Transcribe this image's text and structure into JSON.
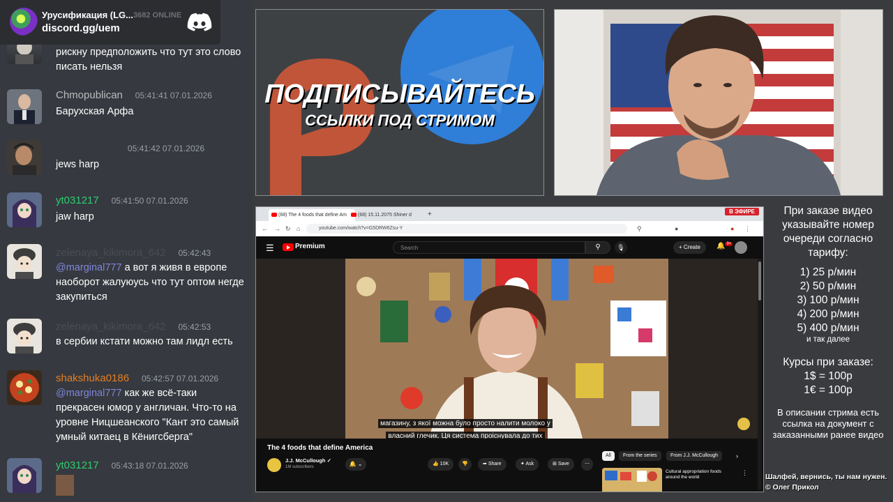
{
  "discord": {
    "server_name": "Урусификация (LG...",
    "online_count": "3682 ONLINE",
    "invite": "discord.gg/uem",
    "messages": [
      {
        "user": "",
        "time": "",
        "text": "рискну предположить что тут это слово писать нельзя",
        "color": "#b9bbbe"
      },
      {
        "user": "Chmopublican",
        "time": "05:41:41 07.01.2026",
        "text": "Барухская Арфа",
        "color": "#b9bbbe"
      },
      {
        "user": "",
        "time": "05:41:42 07.01.2026",
        "text": "jews harp",
        "color": "#4f5a42"
      },
      {
        "user": "yt031217",
        "time": "05:41:50 07.01.2026",
        "text": "jaw harp",
        "color": "#2ecc71"
      },
      {
        "user": "zelenaya_kikimora_642",
        "time": "05:42:43",
        "mention": "@marginal777",
        "text": "а вот я живя в европе наоборот жалуюусь что тут оптом негде закупиться",
        "color": "#4a4d52"
      },
      {
        "user": "zelenaya_kikimora_642",
        "time": "05:42:53",
        "text": "в сербии кстати можно там лидл есть",
        "color": "#4a4d52"
      },
      {
        "user": "shakshuka0186",
        "time": "05:42:57 07.01.2026",
        "mention": "@marginal777",
        "text": "как же всё-таки прекрасен юмор у англичан. Что-то на уровне Ницшеанского \"Кант это самый умный китаец в Кёнигсберга\"",
        "color": "#e67e22"
      },
      {
        "user": "yt031217",
        "time": "05:43:18 07.01.2026",
        "text": "",
        "color": "#2ecc71"
      }
    ]
  },
  "banner": {
    "title": "ПОДПИСЫВАЙТЕСЬ",
    "subtitle": "ССЫЛКИ ПОД СТРИМОМ"
  },
  "browser": {
    "tab1": "(68) The 4 foods that define Am",
    "tab2": "(68) 15.11.2075 Shiner d",
    "live_badge": "В ЭФИРЕ",
    "url": "youtube.com/watch?v=G5DRW6Zsu-Y"
  },
  "youtube": {
    "logo_text": "Premium",
    "search_placeholder": "Search",
    "create_label": "Create",
    "notif_count": "9+",
    "caption_line1": "магазину, з якої можна було просто налити молоко у",
    "caption_line2": "власний глечик. Ця система проіснувала до тих",
    "video_title": "The 4 foods that define America",
    "channel_name": "J.J. McCullough",
    "subscribers": "1M subscribers",
    "likes": "10K",
    "share": "Share",
    "ask": "Ask",
    "save": "Save",
    "chips": [
      "All",
      "From the series",
      "From J.J. McCullough"
    ],
    "rec_title": "Cultural appropriation foods around the world"
  },
  "order_info": {
    "intro": "При заказе видео указывайте номер очереди согласно тарифу:",
    "tariffs": [
      "1) 25 р/мин",
      "2) 50 р/мин",
      "3) 100 р/мин",
      "4) 200 р/мин",
      "5) 400 р/мин"
    ],
    "and_so_on": "и так далее",
    "rates_title": "Курсы при заказе:",
    "rates": [
      "1$ = 100р",
      "1€ = 100р"
    ],
    "description_note": "В описании стрима есть ссылка на документ с заказанными ранее видео",
    "footer_line1": "Шалфей, вернись, ты нам нужен.",
    "footer_line2": "© Олег Прикол"
  },
  "colors": {
    "accent_red": "#d6232c",
    "discord_bg": "#36393f",
    "mention": "#7f86d8"
  }
}
